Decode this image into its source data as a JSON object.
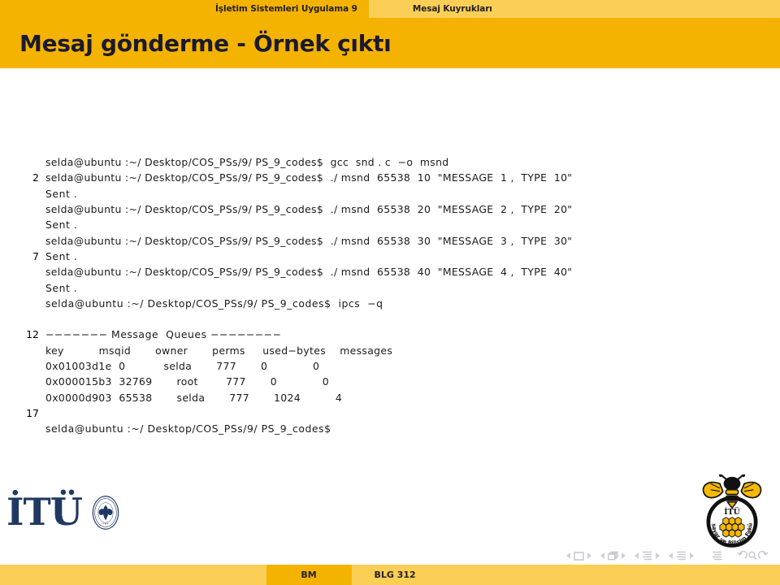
{
  "navbar": {
    "section": "İşletim Sistemleri Uygulama 9",
    "subsection": "Mesaj Kuyrukları"
  },
  "title": "Mesaj gönderme - Örnek çıktı",
  "colors": {
    "accent_dark": "#f5b301",
    "accent_light": "#fbce55",
    "title_text": "#1a1a2e",
    "code_text": "#1a1a1a",
    "logo_navy": "#1f3864",
    "nav_icon": "#c9c7d0"
  },
  "code": {
    "prompt": "selda@ubuntu:~/Desktop/COS_PSs/9/PS_9_codes$",
    "lines": [
      {
        "num": "",
        "text": "selda@ubuntu :~/ Desktop/COS_PSs/9/ PS_9_codes$  gcc  snd . c  −o  msnd"
      },
      {
        "num": "2",
        "text": "selda@ubuntu :~/ Desktop/COS_PSs/9/ PS_9_codes$  ./ msnd  65538  10  \"MESSAGE  1 ,  TYPE  10\""
      },
      {
        "num": "",
        "text": "Sent ."
      },
      {
        "num": "",
        "text": "selda@ubuntu :~/ Desktop/COS_PSs/9/ PS_9_codes$  ./ msnd  65538  20  \"MESSAGE  2 ,  TYPE  20\""
      },
      {
        "num": "",
        "text": "Sent ."
      },
      {
        "num": "",
        "text": "selda@ubuntu :~/ Desktop/COS_PSs/9/ PS_9_codes$  ./ msnd  65538  30  \"MESSAGE  3 ,  TYPE  30\""
      },
      {
        "num": "7",
        "text": "Sent ."
      },
      {
        "num": "",
        "text": "selda@ubuntu :~/ Desktop/COS_PSs/9/ PS_9_codes$  ./ msnd  65538  40  \"MESSAGE  4 ,  TYPE  40\""
      },
      {
        "num": "",
        "text": "Sent ."
      },
      {
        "num": "",
        "text": "selda@ubuntu :~/ Desktop/COS_PSs/9/ PS_9_codes$  ipcs  −q"
      },
      {
        "num": "",
        "text": ""
      },
      {
        "num": "12",
        "text": "−−−−−−− Message  Queues −−−−−−−−"
      },
      {
        "num": "",
        "text": "key          msqid       owner       perms     used−bytes    messages"
      },
      {
        "num": "",
        "text": "0x01003d1e  0           selda       777       0             0"
      },
      {
        "num": "",
        "text": "0x000015b3  32769       root        777       0             0"
      },
      {
        "num": "",
        "text": "0x0000d903  65538       selda       777       1024          4"
      },
      {
        "num": "17",
        "text": ""
      },
      {
        "num": "",
        "text": "selda@ubuntu :~/ Desktop/COS_PSs/9/ PS_9_codes$"
      }
    ]
  },
  "table": {
    "caption": "Message Queues",
    "headers": [
      "key",
      "msqid",
      "owner",
      "perms",
      "used-bytes",
      "messages"
    ],
    "rows": [
      [
        "0x01003d1e",
        "0",
        "selda",
        "777",
        "0",
        "0"
      ],
      [
        "0x000015b3",
        "32769",
        "root",
        "777",
        "0",
        "0"
      ],
      [
        "0x0000d903",
        "65538",
        "selda",
        "777",
        "1024",
        "4"
      ]
    ]
  },
  "footer": {
    "logo_word": "İTÜ",
    "seal_text": "ISTANBUL TECHNICAL UNIVERSITY",
    "seal_year": "1773",
    "bee_logo_top": "İTÜ",
    "bee_logo_text": "Bilgisayar ve Bilişim Fakültesi",
    "status_left": "BM",
    "status_right": "BLG 312"
  },
  "navicons": [
    {
      "name": "slide-nav",
      "glyph": "square"
    },
    {
      "name": "frame-nav",
      "glyph": "frames"
    },
    {
      "name": "subsection-nav",
      "glyph": "lines"
    },
    {
      "name": "section-nav",
      "glyph": "lines"
    },
    {
      "name": "presentation-nav",
      "glyph": "lines-single"
    },
    {
      "name": "back-search-forward",
      "glyph": "tools"
    }
  ]
}
